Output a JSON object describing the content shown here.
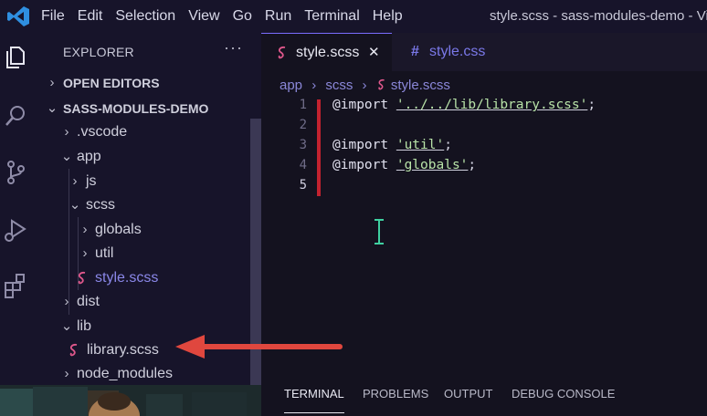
{
  "titlebar": {
    "menu": [
      "File",
      "Edit",
      "Selection",
      "View",
      "Go",
      "Run",
      "Terminal",
      "Help"
    ],
    "window_title": "style.scss - sass-modules-demo - Visu"
  },
  "activitybar": {
    "icons": [
      "files-icon",
      "search-icon",
      "source-control-icon",
      "run-debug-icon",
      "extensions-icon"
    ]
  },
  "sidebar": {
    "title": "EXPLORER",
    "more": "···",
    "sections": {
      "open_editors": "OPEN EDITORS",
      "project": "SASS-MODULES-DEMO"
    },
    "tree": [
      {
        "label": ".vscode",
        "expanded": false,
        "depth": 1
      },
      {
        "label": "app",
        "expanded": true,
        "depth": 1
      },
      {
        "label": "js",
        "expanded": false,
        "depth": 2
      },
      {
        "label": "scss",
        "expanded": true,
        "depth": 2
      },
      {
        "label": "globals",
        "expanded": false,
        "depth": 3
      },
      {
        "label": "util",
        "expanded": false,
        "depth": 3
      },
      {
        "label": "style.scss",
        "file": true,
        "depth": 3
      },
      {
        "label": "dist",
        "expanded": false,
        "depth": 1
      },
      {
        "label": "lib",
        "expanded": true,
        "depth": 1
      },
      {
        "label": "library.scss",
        "file": true,
        "depth": 2
      },
      {
        "label": "node_modules",
        "expanded": false,
        "depth": 1
      }
    ]
  },
  "editor": {
    "tabs": [
      {
        "label": "style.scss",
        "active": true,
        "close": "✕"
      },
      {
        "label": "style.css",
        "active": false,
        "icon": "#"
      }
    ],
    "breadcrumb": [
      "app",
      "scss",
      "style.scss"
    ],
    "lines": [
      {
        "num": "1",
        "kw": "@import",
        "str": "'../../lib/library.scss'",
        "end": ";"
      },
      {
        "num": "2"
      },
      {
        "num": "3",
        "kw": "@import",
        "str": "'util'",
        "end": ";"
      },
      {
        "num": "4",
        "kw": "@import",
        "str": "'globals'",
        "end": ";"
      },
      {
        "num": "5"
      }
    ]
  },
  "panel": {
    "tabs": [
      "TERMINAL",
      "PROBLEMS",
      "OUTPUT",
      "DEBUG CONSOLE"
    ],
    "active_tab": "TERMINAL"
  },
  "colors": {
    "sass_pink": "#e0588c",
    "accent": "#7a6cff",
    "change_bar": "#c3222f",
    "arrow": "#e0473e"
  }
}
